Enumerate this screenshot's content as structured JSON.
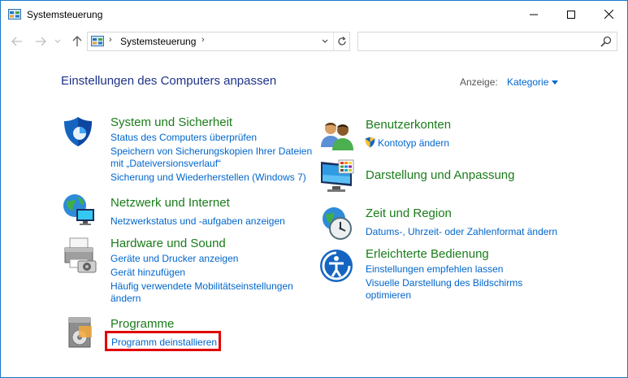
{
  "window": {
    "title": "Systemsteuerung"
  },
  "address": {
    "crumb": "Systemsteuerung",
    "search_placeholder": ""
  },
  "header": {
    "heading": "Einstellungen des Computers anpassen",
    "view_by_label": "Anzeige:",
    "view_by_value": "Kategorie"
  },
  "left": [
    {
      "title": "System und Sicherheit",
      "links": [
        "Status des Computers überprüfen",
        "Speichern von Sicherungskopien Ihrer Dateien",
        "mit „Dateiversionsverlauf“",
        "Sicherung und Wiederherstellen (Windows 7)"
      ]
    },
    {
      "title": "Netzwerk und Internet",
      "links": [
        "Netzwerkstatus und -aufgaben anzeigen"
      ]
    },
    {
      "title": "Hardware und Sound",
      "links": [
        "Geräte und Drucker anzeigen",
        "Gerät hinzufügen",
        "Häufig verwendete Mobilitätseinstellungen",
        "ändern"
      ]
    },
    {
      "title": "Programme",
      "links": [
        "Programm deinstallieren"
      ]
    }
  ],
  "right": [
    {
      "title": "Benutzerkonten",
      "links": [
        "Kontotyp ändern"
      ]
    },
    {
      "title": "Darstellung und Anpassung",
      "links": []
    },
    {
      "title": "Zeit und Region",
      "links": [
        "Datums-, Uhrzeit- oder Zahlenformat ändern"
      ]
    },
    {
      "title": "Erleichterte Bedienung",
      "links": [
        "Einstellungen empfehlen lassen",
        "Visuelle Darstellung des Bildschirms",
        "optimieren"
      ]
    }
  ],
  "icons": {
    "window": "control-panel-icon",
    "system": "shield-icon",
    "network": "globe-network-icon",
    "hardware": "printer-icon",
    "programs": "programs-icon",
    "users": "users-icon",
    "appearance": "monitor-color-icon",
    "clock": "clock-globe-icon",
    "ease": "ease-of-access-icon",
    "uac": "uac-shield-icon"
  },
  "colors": {
    "accent": "#0066cc",
    "category_title": "#1a7c1a",
    "heading": "#1e3287",
    "highlight": "#e00000"
  }
}
